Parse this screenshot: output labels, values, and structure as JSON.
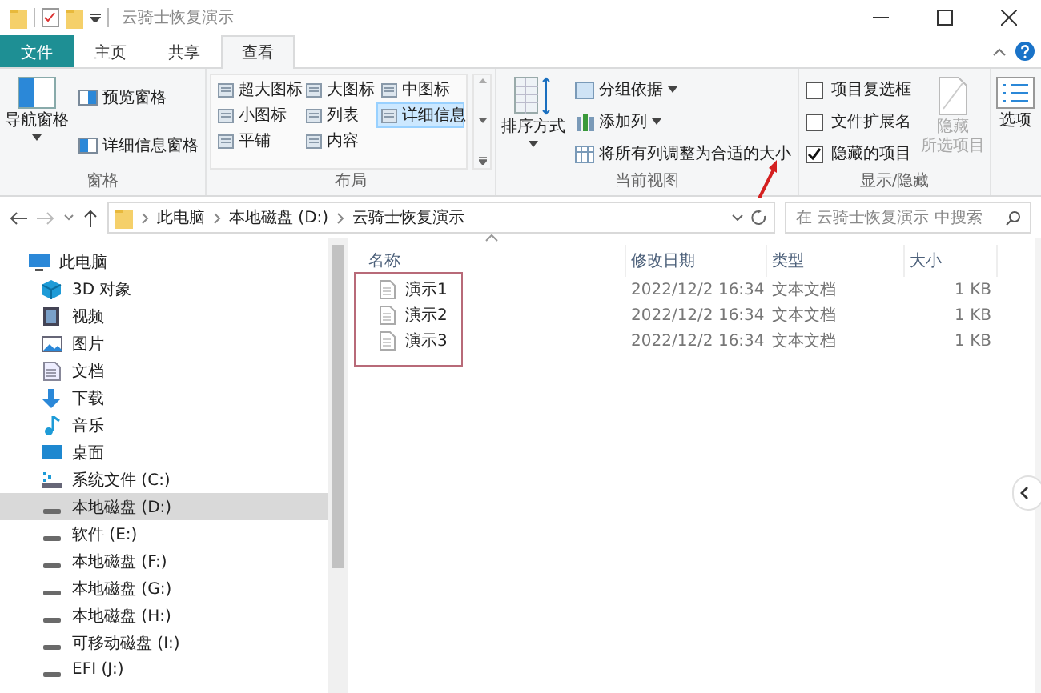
{
  "window": {
    "title": "云骑士恢复演示"
  },
  "tabs": [
    {
      "label": "文件",
      "kind": "file",
      "selected": false
    },
    {
      "label": "主页",
      "kind": "tab",
      "selected": false
    },
    {
      "label": "共享",
      "kind": "tab",
      "selected": false
    },
    {
      "label": "查看",
      "kind": "tab",
      "selected": true
    }
  ],
  "ribbon": {
    "groups": [
      {
        "kind": "panes",
        "label": "窗格",
        "large": {
          "label": "导航窗格",
          "dropdown": true
        },
        "small": [
          {
            "label": "预览窗格",
            "selected": false
          },
          {
            "label": "详细信息窗格",
            "selected": false
          }
        ]
      },
      {
        "kind": "layout",
        "label": "布局",
        "gallery": [
          {
            "label": "超大图标",
            "selected": false
          },
          {
            "label": "大图标",
            "selected": false
          },
          {
            "label": "中图标",
            "selected": false
          },
          {
            "label": "小图标",
            "selected": false
          },
          {
            "label": "列表",
            "selected": false
          },
          {
            "label": "详细信息",
            "selected": true
          },
          {
            "label": "平铺",
            "selected": false
          },
          {
            "label": "内容",
            "selected": false
          }
        ]
      },
      {
        "kind": "view",
        "label": "当前视图",
        "large": {
          "label": "排序方式",
          "dropdown": true
        },
        "small": [
          {
            "label": "分组依据",
            "dropdown": true
          },
          {
            "label": "添加列",
            "dropdown": true
          },
          {
            "label": "将所有列调整为合适的大小",
            "dropdown": false
          }
        ]
      },
      {
        "kind": "showhide",
        "label": "显示/隐藏",
        "checks": [
          {
            "label": "项目复选框",
            "checked": false
          },
          {
            "label": "文件扩展名",
            "checked": false
          },
          {
            "label": "隐藏的项目",
            "checked": true
          }
        ],
        "large": {
          "lines": [
            "隐藏",
            "所选项目"
          ],
          "disabled": true
        }
      },
      {
        "kind": "options",
        "large": {
          "label": "选项",
          "dropdown": false
        }
      }
    ]
  },
  "address": {
    "path": [
      "此电脑",
      "本地磁盘 (D:)",
      "云骑士恢复演示"
    ],
    "search": {
      "placeholder": "在 云骑士恢复演示 中搜索"
    }
  },
  "sidebar": {
    "items": [
      {
        "label": "此电脑",
        "kind": "pc",
        "selected": false,
        "children": [
          {
            "label": "3D 对象",
            "kind": "cube",
            "selected": false
          },
          {
            "label": "视频",
            "kind": "film",
            "selected": false
          },
          {
            "label": "图片",
            "kind": "picture",
            "selected": false
          },
          {
            "label": "文档",
            "kind": "document",
            "selected": false
          },
          {
            "label": "下载",
            "kind": "download",
            "selected": false
          },
          {
            "label": "音乐",
            "kind": "music",
            "selected": false
          },
          {
            "label": "桌面",
            "kind": "desktop",
            "selected": false
          },
          {
            "label": "系统文件 (C:)",
            "kind": "system",
            "selected": false
          },
          {
            "label": "本地磁盘 (D:)",
            "kind": "drive",
            "selected": true
          },
          {
            "label": "软件 (E:)",
            "kind": "drive",
            "selected": false
          },
          {
            "label": "本地磁盘 (F:)",
            "kind": "drive",
            "selected": false
          },
          {
            "label": "本地磁盘 (G:)",
            "kind": "drive",
            "selected": false
          },
          {
            "label": "本地磁盘 (H:)",
            "kind": "drive",
            "selected": false
          },
          {
            "label": "可移动磁盘 (I:)",
            "kind": "drive",
            "selected": false
          },
          {
            "label": "EFI (J:)",
            "kind": "drive",
            "selected": false
          }
        ]
      }
    ]
  },
  "table": {
    "columns": [
      "名称",
      "修改日期",
      "类型",
      "大小"
    ],
    "rows": [
      [
        "演示1",
        "2022/12/2 16:34",
        "文本文档",
        "1 KB"
      ],
      [
        "演示2",
        "2022/12/2 16:34",
        "文本文档",
        "1 KB"
      ],
      [
        "演示3",
        "2022/12/2 16:34",
        "文本文档",
        "1 KB"
      ]
    ]
  }
}
